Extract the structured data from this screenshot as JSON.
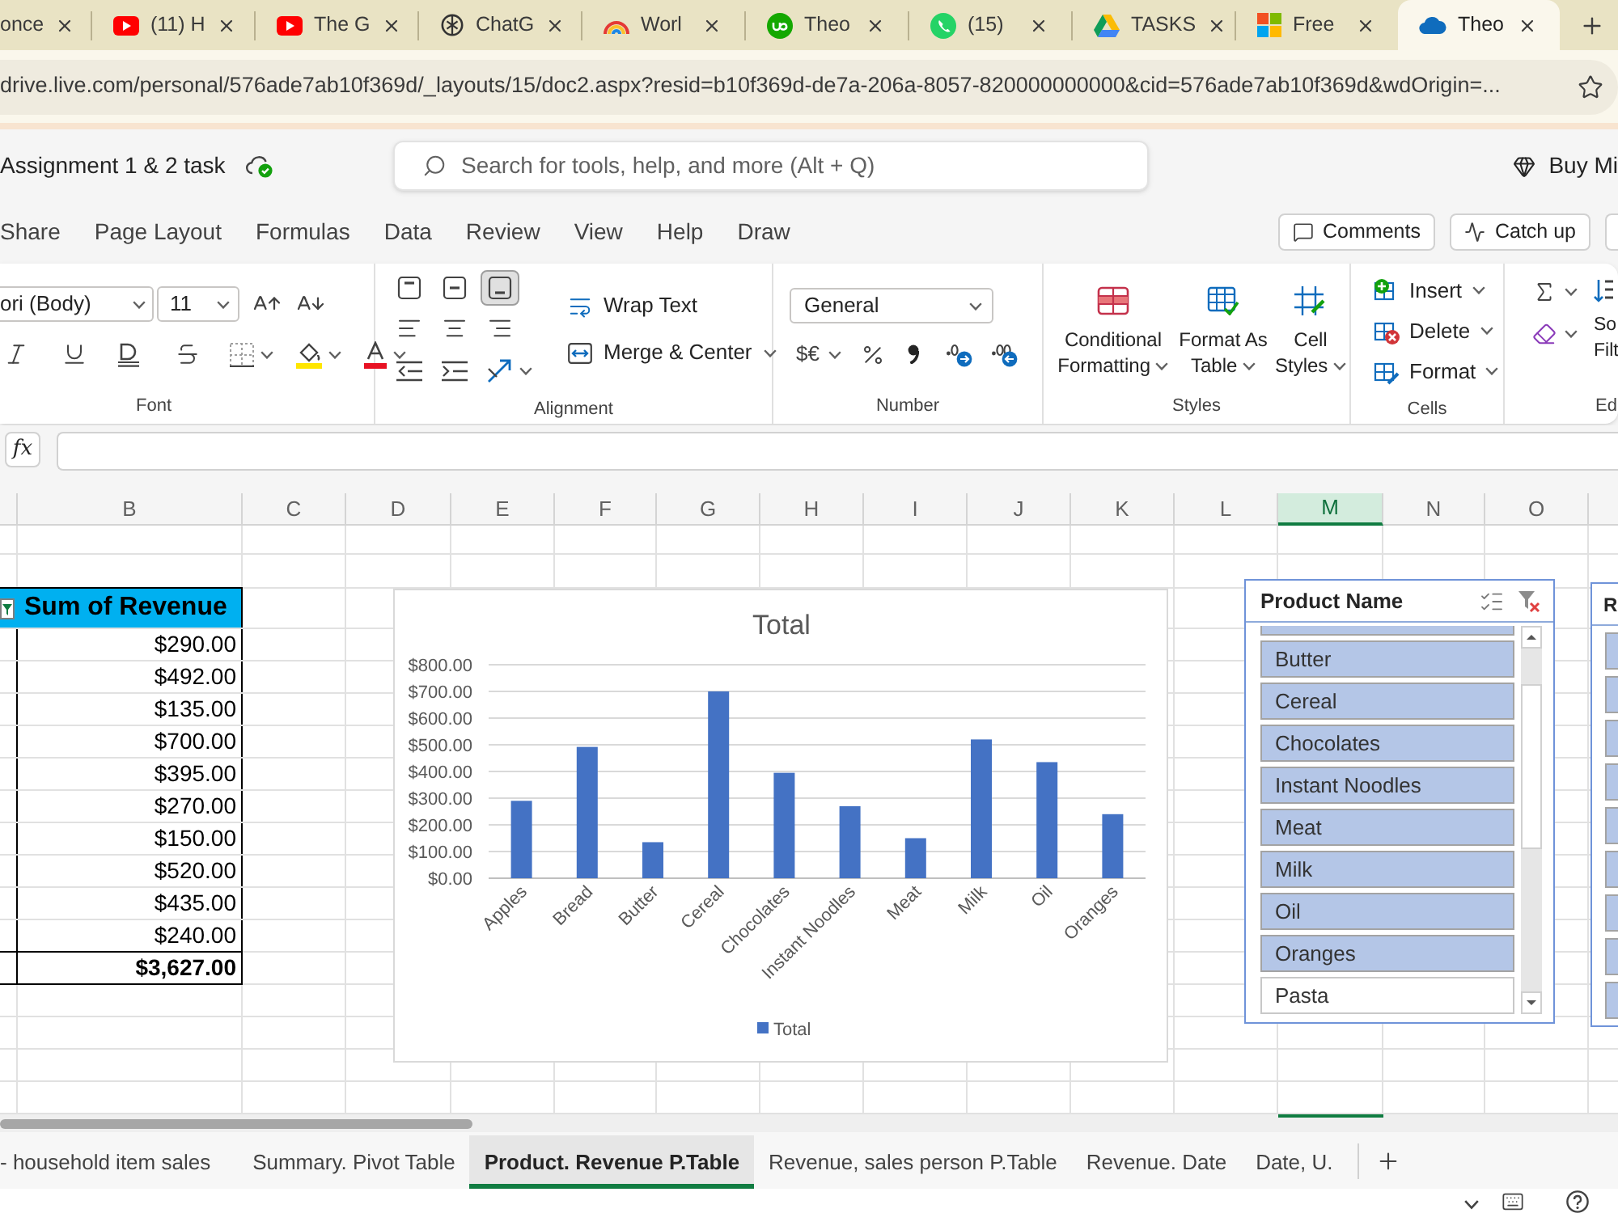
{
  "browser": {
    "tabs": [
      {
        "title": "once",
        "kind": "plain",
        "selected": false
      },
      {
        "title": "(11) H",
        "kind": "red-play",
        "selected": false
      },
      {
        "title": "The G",
        "kind": "red-play",
        "selected": false
      },
      {
        "title": "ChatG",
        "kind": "knot",
        "selected": false
      },
      {
        "title": "Worl",
        "kind": "rainbow",
        "selected": false
      },
      {
        "title": "Theo",
        "kind": "green-circle",
        "selected": false
      },
      {
        "title": "(15)",
        "kind": "green-phone",
        "selected": false
      },
      {
        "title": "TASKS",
        "kind": "triangle",
        "selected": false
      },
      {
        "title": "Free",
        "kind": "four-squares",
        "selected": false
      },
      {
        "title": "Theo",
        "kind": "cloud",
        "selected": true
      }
    ],
    "address": "drive.live.com/personal/576ade7ab10f369d/_layouts/15/doc2.aspx?resid=b10f369d-de7a-206a-8057-820000000000&cid=576ade7ab10f369d&wdOrigin=..."
  },
  "app_header": {
    "document_title": "Assignment 1 & 2 task",
    "search": {
      "placeholder": "Search for tools, help, and more (Alt + Q)"
    },
    "buy_button": "Buy Mi"
  },
  "menu": {
    "tabs": [
      {
        "label": "Share",
        "selected": false
      },
      {
        "label": "Page Layout",
        "selected": false
      },
      {
        "label": "Formulas",
        "selected": false
      },
      {
        "label": "Data",
        "selected": false
      },
      {
        "label": "Review",
        "selected": false
      },
      {
        "label": "View",
        "selected": false
      },
      {
        "label": "Help",
        "selected": false
      },
      {
        "label": "Draw",
        "selected": false
      }
    ],
    "buttons": [
      {
        "label": "Comments",
        "kind": "comments"
      },
      {
        "label": "Catch up",
        "kind": "catchup"
      }
    ]
  },
  "ribbon": {
    "font": {
      "label": "Font",
      "font_name": "ori (Body)",
      "font_size": "11"
    },
    "alignment": {
      "label": "Alignment",
      "vertical_align": [
        {
          "kind": "top",
          "selected": false
        },
        {
          "kind": "middle",
          "selected": false
        },
        {
          "kind": "bottom",
          "selected": true
        }
      ],
      "wrap_text": "Wrap Text",
      "merge": "Merge & Center"
    },
    "number": {
      "label": "Number",
      "format": "General",
      "currency": "$€"
    },
    "styles": {
      "label": "Styles",
      "buttons": [
        {
          "label": "Conditional Formatting",
          "kind": "conditional"
        },
        {
          "label": "Format As Table",
          "kind": "table"
        },
        {
          "label": "Cell Styles",
          "kind": "cell"
        }
      ]
    },
    "cells": {
      "label": "Cells",
      "buttons": [
        {
          "label": "Insert",
          "kind": "insert"
        },
        {
          "label": "Delete",
          "kind": "delete"
        },
        {
          "label": "Format",
          "kind": "format"
        }
      ]
    },
    "editing": {
      "label": "Ed",
      "sort_filter": "So Filt"
    }
  },
  "formula_bar": {
    "function_button": "fx"
  },
  "sheet": {
    "columns": [
      {
        "label": "B",
        "selected": false
      },
      {
        "label": "C",
        "selected": false
      },
      {
        "label": "D",
        "selected": false
      },
      {
        "label": "E",
        "selected": false
      },
      {
        "label": "F",
        "selected": false
      },
      {
        "label": "G",
        "selected": false
      },
      {
        "label": "H",
        "selected": false
      },
      {
        "label": "I",
        "selected": false
      },
      {
        "label": "J",
        "selected": false
      },
      {
        "label": "K",
        "selected": false
      },
      {
        "label": "L",
        "selected": false
      },
      {
        "label": "M",
        "selected": true
      },
      {
        "label": "N",
        "selected": false
      },
      {
        "label": "O",
        "selected": false
      }
    ],
    "pivot_table": {
      "header": "Sum of Revenue",
      "values": [
        "$290.00",
        "$492.00",
        "$135.00",
        "$700.00",
        "$395.00",
        "$270.00",
        "$150.00",
        "$520.00",
        "$435.00",
        "$240.00"
      ],
      "total": "$3,627.00"
    },
    "chart": {
      "chart_data": {
        "type": "bar",
        "title": "Total",
        "grid": true,
        "categories": [
          "Apples",
          "Bread",
          "Butter",
          "Cereal",
          "Chocolates",
          "Instant Noodles",
          "Meat",
          "Milk",
          "Oil",
          "Oranges"
        ],
        "series": [
          {
            "name": "Total",
            "color": "#4472c4",
            "values": [
              290,
              492,
              135,
              700,
              395,
              270,
              150,
              520,
              435,
              240
            ]
          }
        ],
        "ylim": [
          0,
          800
        ],
        "yticks": [
          {
            "value": 0,
            "label": "$0.00"
          },
          {
            "value": 100,
            "label": "$100.00"
          },
          {
            "value": 200,
            "label": "$200.00"
          },
          {
            "value": 300,
            "label": "$300.00"
          },
          {
            "value": 400,
            "label": "$400.00"
          },
          {
            "value": 500,
            "label": "$500.00"
          },
          {
            "value": 600,
            "label": "$600.00"
          },
          {
            "value": 700,
            "label": "$700.00"
          },
          {
            "value": 800,
            "label": "$800.00"
          }
        ]
      }
    },
    "slicer": {
      "title": "Product Name",
      "top_item_cut": {
        "selected": true
      },
      "items": [
        {
          "label": "Butter",
          "selected": true
        },
        {
          "label": "Cereal",
          "selected": true
        },
        {
          "label": "Chocolates",
          "selected": true
        },
        {
          "label": "Instant Noodles",
          "selected": true
        },
        {
          "label": "Meat",
          "selected": true
        },
        {
          "label": "Milk",
          "selected": true
        },
        {
          "label": "Oil",
          "selected": true
        },
        {
          "label": "Oranges",
          "selected": true
        },
        {
          "label": "Pasta",
          "selected": false
        }
      ]
    },
    "second_slicer": {
      "title": "R",
      "items": [
        {
          "selected": true
        },
        {
          "selected": true
        },
        {
          "selected": true
        },
        {
          "selected": true
        },
        {
          "selected": true
        },
        {
          "selected": true
        },
        {
          "selected": true
        },
        {
          "selected": true
        },
        {
          "selected": true
        }
      ]
    }
  },
  "sheet_tabs": [
    {
      "label": "- household item sales",
      "selected": false
    },
    {
      "label": "Summary. Pivot Table",
      "selected": false
    },
    {
      "label": "Product. Revenue P.Table",
      "selected": true
    },
    {
      "label": "Revenue, sales person P.Table",
      "selected": false
    },
    {
      "label": "Revenue. Date",
      "selected": false
    },
    {
      "label": "Date, U.",
      "selected": false
    }
  ]
}
